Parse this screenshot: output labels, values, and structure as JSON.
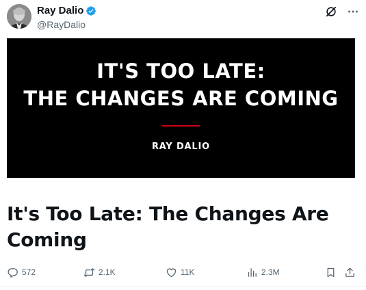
{
  "author": {
    "display_name": "Ray Dalio",
    "handle": "@RayDalio",
    "verified": true
  },
  "media_card": {
    "headline_line1": "IT'S TOO LATE:",
    "headline_line2": "THE CHANGES ARE COMING",
    "caption": "RAY DALIO",
    "background_color": "#000000",
    "accent_color": "#d0021b"
  },
  "article": {
    "title": "It's Too Late: The Changes Are Coming"
  },
  "actions": {
    "replies": "572",
    "reposts": "2.1K",
    "likes": "11K",
    "views": "2.3M"
  },
  "icons": {
    "verified": "verified-badge-icon",
    "grok": "grok-icon",
    "more": "more-icon",
    "reply": "reply-icon",
    "repost": "repost-icon",
    "like": "heart-icon",
    "views": "views-chart-icon",
    "bookmark": "bookmark-icon",
    "share": "share-icon"
  },
  "colors": {
    "verified_blue": "#1d9bf0",
    "secondary_text": "#536471",
    "primary_text": "#0f1419"
  }
}
